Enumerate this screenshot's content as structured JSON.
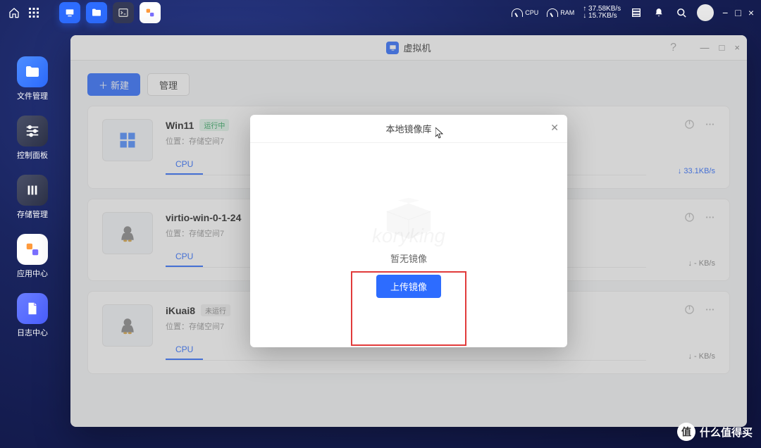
{
  "topbar": {
    "cpu_label": "CPU",
    "ram_label": "RAM",
    "net_up": "↑ 37.58KB/s",
    "net_down": "↓ 15.7KB/s"
  },
  "dock": {
    "items": [
      {
        "label": "文件管理"
      },
      {
        "label": "控制面板"
      },
      {
        "label": "存储管理"
      },
      {
        "label": "应用中心"
      },
      {
        "label": "日志中心"
      }
    ]
  },
  "window": {
    "title": "虚拟机",
    "help": "?",
    "toolbar": {
      "new_icon": "＋",
      "new_label": "新建",
      "manage_label": "管理"
    }
  },
  "vms": [
    {
      "thumb": "win",
      "name": "Win11",
      "status": "运行中",
      "status_class": "badge-green",
      "location": "位置：存储空间7",
      "tab_cpu": "CPU",
      "speed_icon": "↓",
      "speed": "33.1KB/s",
      "speed_class": ""
    },
    {
      "thumb": "linux",
      "name": "virtio-win-0-1-24",
      "status": "",
      "status_class": "badge-gray",
      "location": "位置：存储空间7",
      "tab_cpu": "CPU",
      "speed_icon": "↓",
      "speed": "- KB/s",
      "speed_class": "muted"
    },
    {
      "thumb": "linux",
      "name": "iKuai8",
      "status": "未运行",
      "status_class": "badge-gray",
      "location": "位置：存储空间7",
      "tab_cpu": "CPU",
      "speed_icon": "↓",
      "speed": "- KB/s",
      "speed_class": "muted"
    }
  ],
  "modal": {
    "title": "本地镜像库",
    "watermark": "koryking",
    "empty_text": "暂无镜像",
    "upload_label": "上传镜像"
  },
  "site_badge": {
    "mark": "值",
    "text": "什么值得买"
  }
}
